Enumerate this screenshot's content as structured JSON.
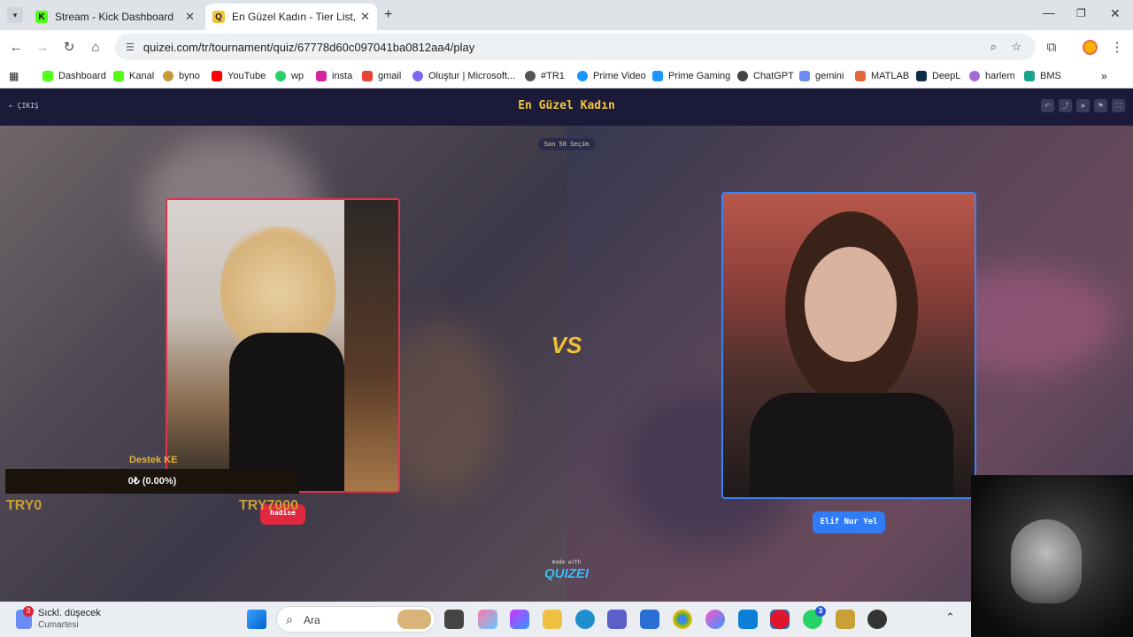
{
  "browser": {
    "tabs": [
      {
        "title": "Stream - Kick Dashboard",
        "active": false,
        "favicon": "kick-icon"
      },
      {
        "title": "En Güzel Kadın - Tier List, Kör S",
        "active": true,
        "favicon": "quizei-icon"
      }
    ],
    "url": "quizei.com/tr/tournament/quiz/67778d60c097041ba0812aa4/play",
    "bookmarks": [
      "Dashboard",
      "Kanal",
      "byno",
      "YouTube",
      "wp",
      "insta",
      "gmail",
      "Oluştur | Microsoft...",
      "#TR1",
      "Prime Video",
      "Prime Gaming",
      "ChatGPT",
      "gemini",
      "MATLAB",
      "DeepL",
      "harlem",
      "BMS"
    ]
  },
  "page": {
    "exit_label": "← ÇIKIŞ",
    "title": "En Güzel Kadın",
    "last_choices": "Son 50 Seçim",
    "vs_label": "VS",
    "left_choice": "hadise",
    "right_choice": "Elif Nur Yel",
    "made_with": "made with",
    "brand": "QUIZEI"
  },
  "overlay": {
    "donate_title": "Destek KE",
    "donate_amount": "0₺ (0.00%)",
    "goal_current": "TRY0",
    "goal_target": "TRY7000"
  },
  "taskbar": {
    "weather_title": "Sıckl. düşecek",
    "weather_sub": "Cumartesi",
    "weather_badge": "3",
    "search_placeholder": "Ara",
    "whatsapp_badge": "3"
  },
  "colors": {
    "accent_title": "#f3c53c",
    "left_border": "#e0324f",
    "right_border": "#3b82f6"
  }
}
